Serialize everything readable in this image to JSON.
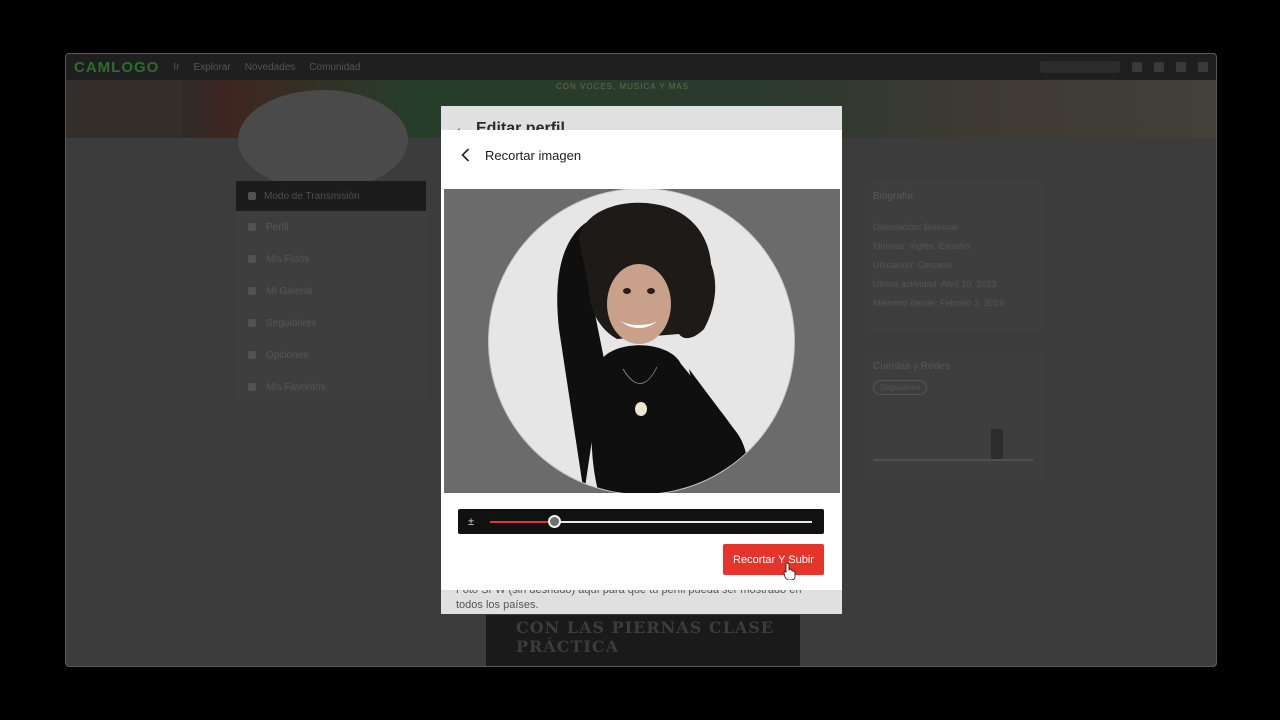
{
  "site": {
    "logo": "CAMLOGO",
    "nav": [
      "Ir",
      "Explorar",
      "Novedades",
      "Comunidad"
    ],
    "banner_text": "CON VOCES, MUSICA Y MAS"
  },
  "sidebar": {
    "header": "Modo de Transmisión",
    "items": [
      "Perfil",
      "Mis Fotos",
      "Mi Galería",
      "Seguidores",
      "Opciones",
      "Mis Favoritos"
    ]
  },
  "right_panel": {
    "title": "Biografía",
    "lines": [
      "Orientación: Bisexual",
      "Idiomas: Inglés, Español",
      "Ubicación: Cercana",
      "Última actividad: Abril 10, 2023",
      "Miembro desde: Febrero 3, 2019"
    ],
    "panel2_title": "Cuentas y Redes",
    "chip": "Seguidores"
  },
  "modal_back": {
    "title": "Editar perfil",
    "footer_text": "Foto SFW (sin desnudo) aquí para que tu perfil pueda ser mostrado en todos los países."
  },
  "modal": {
    "title": "Recortar imagen",
    "zoom_icon": "±",
    "zoom_level": 0.2,
    "submit_label": "Recortar Y Subir"
  },
  "poster_text": "CON LAS PIERNAS CLASE PRÁCTICA",
  "colors": {
    "accent": "#e5352b",
    "overlay_dark": "#3c3c3c"
  }
}
